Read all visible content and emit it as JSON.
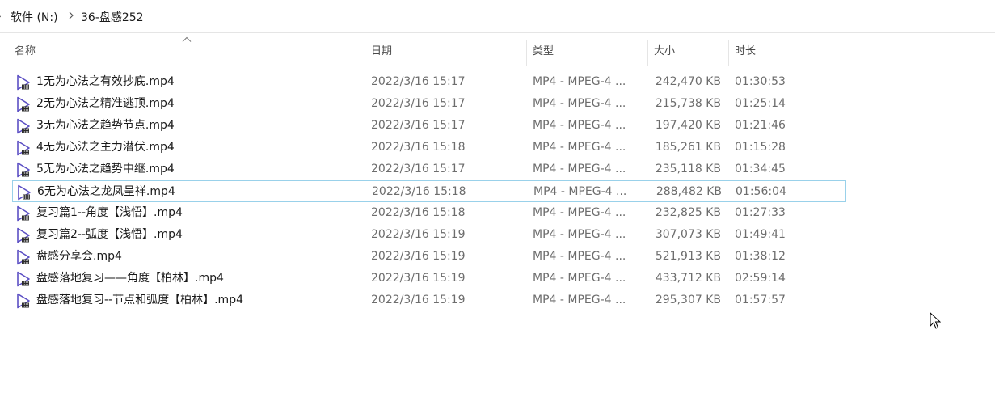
{
  "breadcrumb": {
    "drive": "软件 (N:)",
    "folder": "36-盘感252"
  },
  "columns": {
    "name": "名称",
    "date": "日期",
    "type": "类型",
    "size": "大小",
    "duration": "时长"
  },
  "files": [
    {
      "name": "1无为心法之有效抄底.mp4",
      "date": "2022/3/16 15:17",
      "type": "MP4 - MPEG-4 ...",
      "size": "242,470 KB",
      "duration": "01:30:53"
    },
    {
      "name": "2无为心法之精准逃顶.mp4",
      "date": "2022/3/16 15:17",
      "type": "MP4 - MPEG-4 ...",
      "size": "215,738 KB",
      "duration": "01:25:14"
    },
    {
      "name": "3无为心法之趋势节点.mp4",
      "date": "2022/3/16 15:17",
      "type": "MP4 - MPEG-4 ...",
      "size": "197,420 KB",
      "duration": "01:21:46"
    },
    {
      "name": "4无为心法之主力潜伏.mp4",
      "date": "2022/3/16 15:18",
      "type": "MP4 - MPEG-4 ...",
      "size": "185,261 KB",
      "duration": "01:15:28"
    },
    {
      "name": "5无为心法之趋势中继.mp4",
      "date": "2022/3/16 15:17",
      "type": "MP4 - MPEG-4 ...",
      "size": "235,118 KB",
      "duration": "01:34:45"
    },
    {
      "name": "6无为心法之龙凤呈祥.mp4",
      "date": "2022/3/16 15:18",
      "type": "MP4 - MPEG-4 ...",
      "size": "288,482 KB",
      "duration": "01:56:04"
    },
    {
      "name": "复习篇1--角度【浅悟】.mp4",
      "date": "2022/3/16 15:18",
      "type": "MP4 - MPEG-4 ...",
      "size": "232,825 KB",
      "duration": "01:27:33"
    },
    {
      "name": "复习篇2--弧度【浅悟】.mp4",
      "date": "2022/3/16 15:19",
      "type": "MP4 - MPEG-4 ...",
      "size": "307,073 KB",
      "duration": "01:49:41"
    },
    {
      "name": "盘感分享会.mp4",
      "date": "2022/3/16 15:19",
      "type": "MP4 - MPEG-4 ...",
      "size": "521,913 KB",
      "duration": "01:38:12"
    },
    {
      "name": "盘感落地复习——角度【柏林】.mp4",
      "date": "2022/3/16 15:19",
      "type": "MP4 - MPEG-4 ...",
      "size": "433,712 KB",
      "duration": "02:59:14"
    },
    {
      "name": "盘感落地复习--节点和弧度【柏林】.mp4",
      "date": "2022/3/16 15:19",
      "type": "MP4 - MPEG-4 ...",
      "size": "295,307 KB",
      "duration": "01:57:57"
    }
  ],
  "focused_row": 5,
  "icons": {
    "file": "video-file-icon",
    "separator": "chevron-right-icon",
    "sort": "sort-up-icon",
    "cursor": "mouse-pointer-icon"
  },
  "colors": {
    "icon_stroke": "#5b4fc4",
    "focus_border": "#99d1ea"
  }
}
